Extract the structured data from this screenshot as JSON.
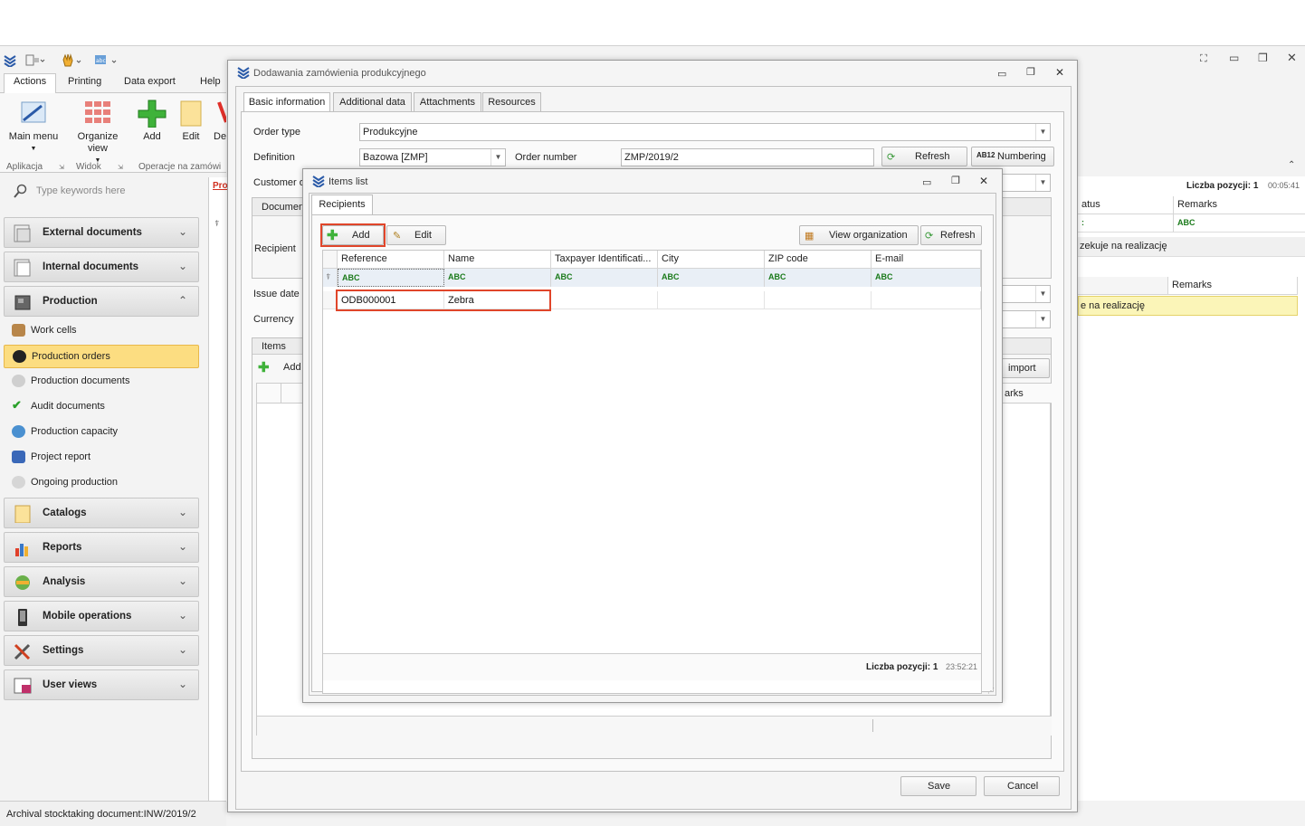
{
  "ribbon": {
    "tabs": [
      "Actions",
      "Printing",
      "Data export",
      "Help"
    ],
    "buttons": {
      "main_menu": "Main menu",
      "organize_view": "Organize view",
      "add": "Add",
      "edit": "Edit",
      "delete_partial": "De"
    },
    "groups": {
      "aplikacja": "Aplikacja",
      "widok": "Widok",
      "operacje": "Operacje na zamówi"
    }
  },
  "nav": {
    "search_placeholder": "Type keywords here",
    "groups": [
      {
        "label": "External documents"
      },
      {
        "label": "Internal documents"
      },
      {
        "label": "Production"
      },
      {
        "label": "Catalogs"
      },
      {
        "label": "Reports"
      },
      {
        "label": "Analysis"
      },
      {
        "label": "Mobile operations"
      },
      {
        "label": "Settings"
      },
      {
        "label": "User views"
      }
    ],
    "production_items": [
      {
        "label": "Work cells"
      },
      {
        "label": "Production orders"
      },
      {
        "label": "Production documents"
      },
      {
        "label": "Audit documents"
      },
      {
        "label": "Production capacity"
      },
      {
        "label": "Project report"
      },
      {
        "label": "Ongoing production"
      }
    ]
  },
  "statusbar": {
    "text": "Archival stocktaking document:INW/2019/2"
  },
  "behind": {
    "pro_tab": "Pro",
    "count": "Liczba pozycji: 1",
    "time": "00:05:41",
    "col_status": "atus",
    "col_remarks": "Remarks",
    "row_status": "zekuje na realizację",
    "col_remarks2": "Remarks",
    "row_status2": "e na realizację"
  },
  "order_dialog": {
    "title": "Dodawania zamówienia produkcyjnego",
    "tabs": [
      "Basic information",
      "Additional data",
      "Attachments",
      "Resources"
    ],
    "order_type_label": "Order type",
    "order_type_value": "Produkcyjne",
    "definition_label": "Definition",
    "definition_value": "Bazowa [ZMP]",
    "order_number_label": "Order number",
    "order_number_value": "ZMP/2019/2",
    "refresh": "Refresh",
    "numbering": "Numbering",
    "customer_label": "Customer o",
    "document_tab": "Document",
    "recipient_label": "Recipient",
    "issue_date_label": "Issue date",
    "currency_label": "Currency",
    "items_label": "Items",
    "items_add": "Add",
    "import": "import",
    "remarks_partial": "arks",
    "save": "Save",
    "cancel": "Cancel"
  },
  "items_dialog": {
    "title": "Items list",
    "tab": "Recipients",
    "add": "Add",
    "edit": "Edit",
    "view_org": "View organization",
    "refresh": "Refresh",
    "columns": [
      "Reference",
      "Name",
      "Taxpayer Identificati...",
      "City",
      "ZIP code",
      "E-mail"
    ],
    "filter_glyph": "ABC",
    "rows": [
      {
        "reference": "ODB000001",
        "name": "Zebra"
      }
    ],
    "count": "Liczba pozycji: 1",
    "time": "23:52:21"
  }
}
